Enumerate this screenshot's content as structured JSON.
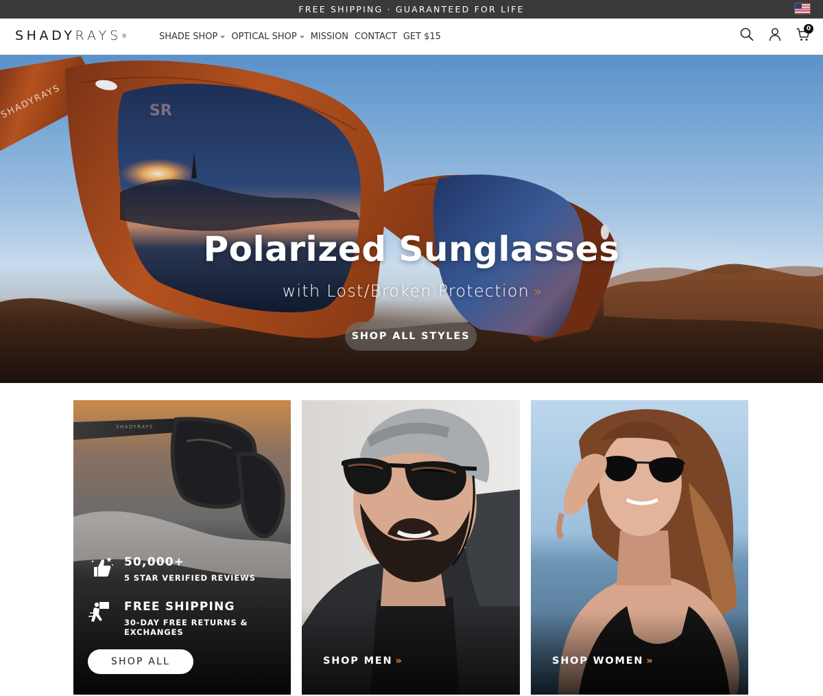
{
  "announcement": {
    "text": "FREE SHIPPING · GUARANTEED FOR LIFE",
    "flag_icon": "us-flag-icon"
  },
  "header": {
    "logo_shady": "SHADY",
    "logo_rays": "RAYS",
    "logo_reg": "®",
    "nav": [
      {
        "label": "SHADE SHOP",
        "has_dropdown": true
      },
      {
        "label": "OPTICAL SHOP",
        "has_dropdown": true
      },
      {
        "label": "MISSION",
        "has_dropdown": false
      },
      {
        "label": "CONTACT",
        "has_dropdown": false
      },
      {
        "label": "GET $15",
        "has_dropdown": false
      }
    ],
    "icons": [
      "search-icon",
      "account-icon",
      "cart-icon"
    ],
    "cart_count": "0"
  },
  "hero": {
    "title": "Polarized Sunglasses",
    "subtitle": "with Lost/Broken Protection",
    "subtitle_chevron": "»",
    "button": "SHOP ALL STYLES",
    "frame_brand": "SHADYRAYS",
    "lens_mark": "SR",
    "accent_color": "#f08a3c"
  },
  "tiles": {
    "all": {
      "brand_mark": "SHADYRAYS",
      "reviews_count": "50,000+",
      "reviews_text": "5 STAR VERIFIED REVIEWS",
      "shipping_title": "FREE SHIPPING",
      "shipping_text": "30-DAY FREE RETURNS & EXCHANGES",
      "button": "SHOP ALL"
    },
    "men": {
      "cta": "SHOP MEN",
      "chevron": "»"
    },
    "women": {
      "cta": "SHOP WOMEN",
      "chevron": "»"
    }
  }
}
